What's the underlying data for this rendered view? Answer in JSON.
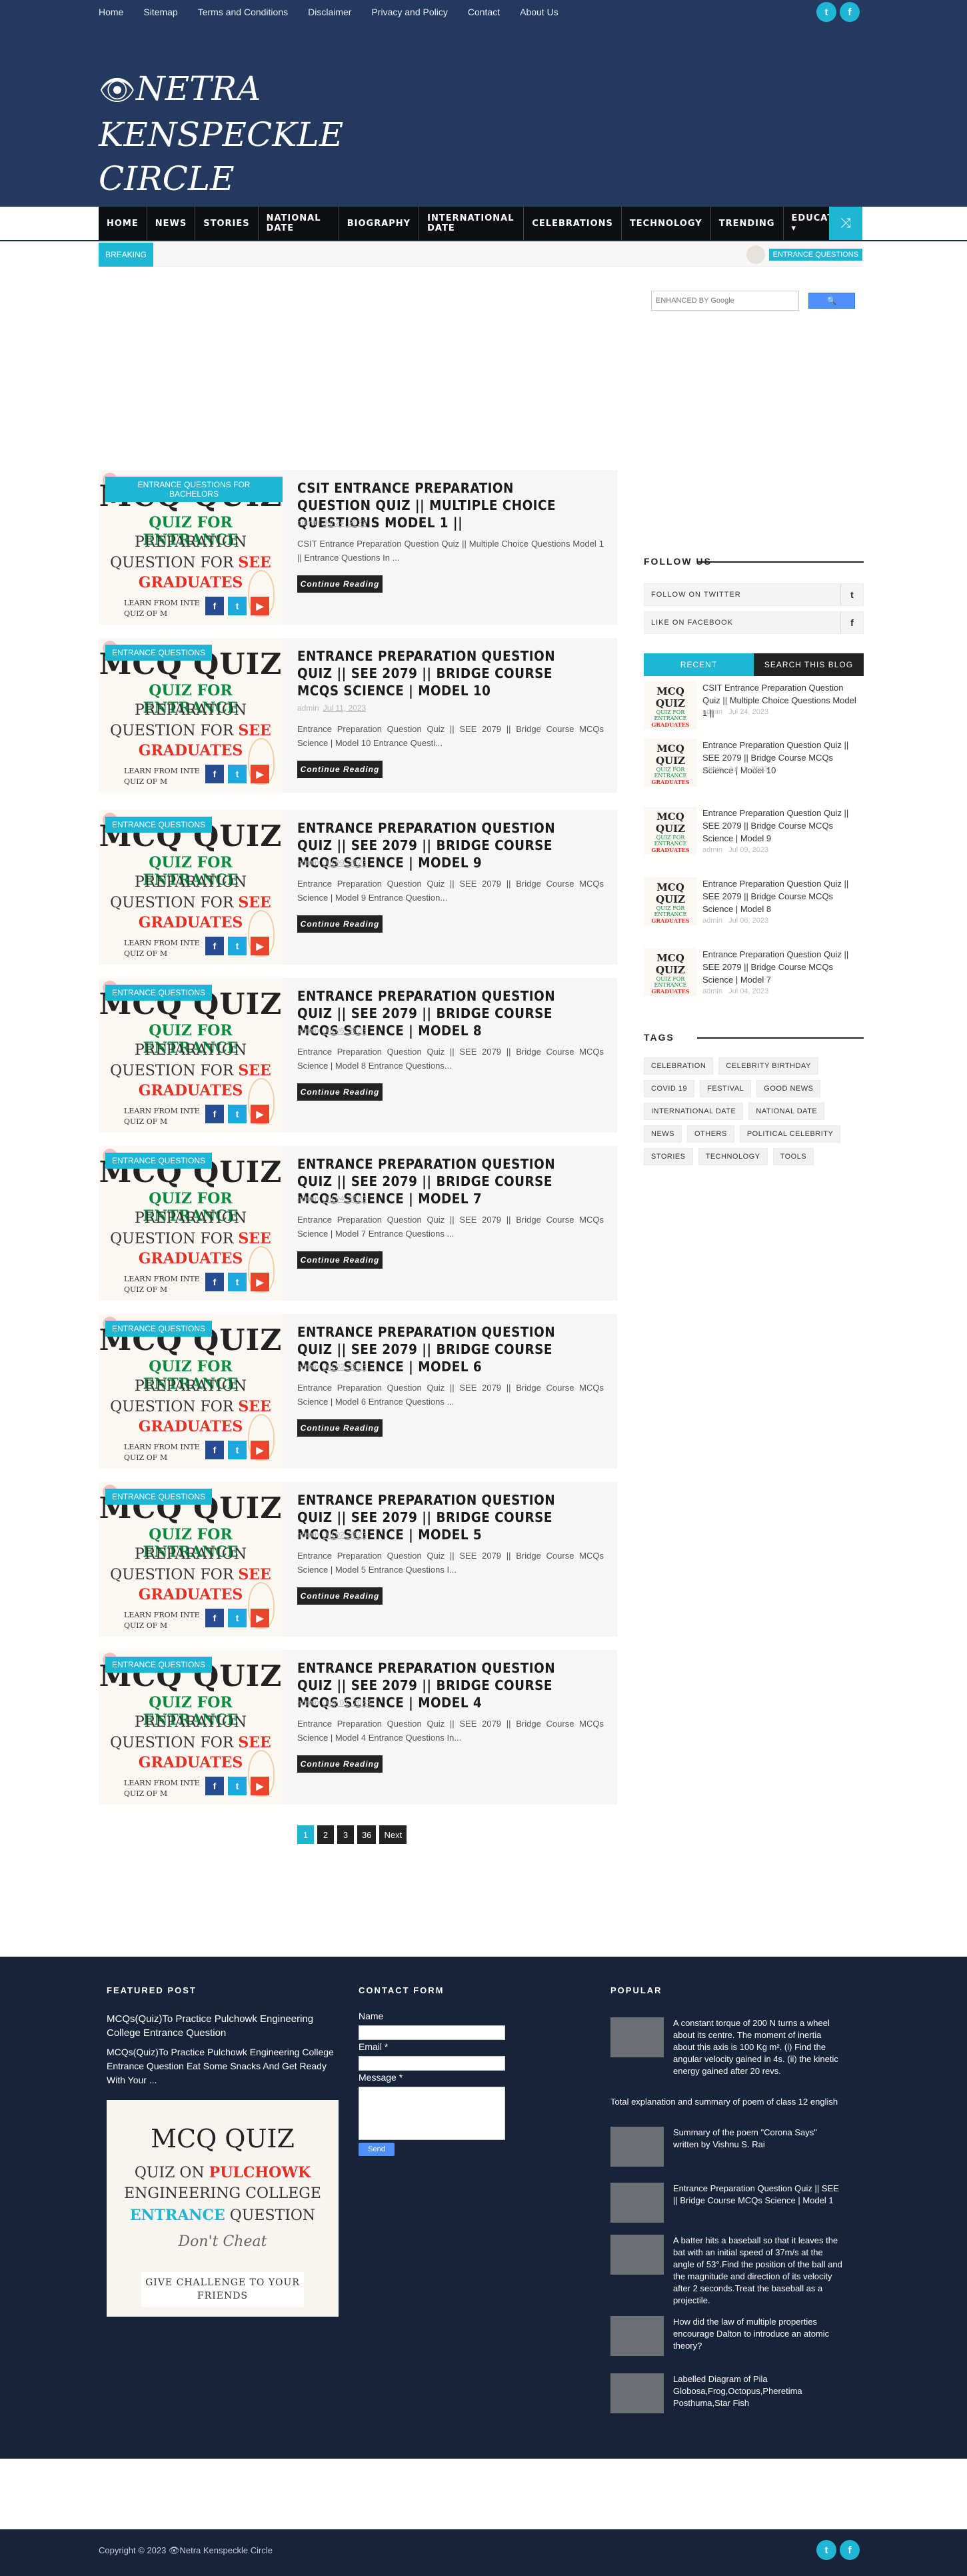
{
  "topnav": [
    "Home",
    "Sitemap",
    "Terms and Conditions",
    "Disclaimer",
    "Privacy and Policy",
    "Contact",
    "About Us"
  ],
  "social": {
    "twitter": "t",
    "facebook": "f"
  },
  "site": {
    "title_line1": "NETRA",
    "title_line2": "KENSPECKLE",
    "title_line3": "CIRCLE",
    "eye": "👁"
  },
  "mainnav": [
    "HOME",
    "NEWS",
    "STORIES",
    "NATIONAL DATE",
    "BIOGRAPHY",
    "INTERNATIONAL DATE",
    "CELEBRATIONS",
    "TECHNOLOGY",
    "TRENDING",
    "EDUCATION ▾"
  ],
  "ticker": {
    "label": "BREAKING",
    "tag": "ENTRANCE QUESTIONS"
  },
  "search": {
    "placeholder": "ENHANCED BY Google",
    "button": "🔍"
  },
  "posts": [
    {
      "category": "ENTRANCE QUESTIONS FOR BACHELORS",
      "title": "CSIT ENTRANCE PREPARATION QUESTION QUIZ || MULTIPLE CHOICE QUESTIONS MODEL 1 ||",
      "author": "admin",
      "date": "Jul 24, 2023",
      "excerpt": "CSIT Entrance Preparation Question Quiz || Multiple Choice Questions Model 1 || Entrance Questions In ..."
    },
    {
      "category": "ENTRANCE QUESTIONS",
      "title": "ENTRANCE PREPARATION QUESTION QUIZ || SEE 2079 || BRIDGE COURSE MCQS SCIENCE | MODEL 10",
      "author": "admin",
      "date": "Jul 11, 2023",
      "excerpt": "Entrance Preparation Question Quiz || SEE 2079 || Bridge Course MCQs Science | Model 10 Entrance Questi..."
    },
    {
      "category": "ENTRANCE QUESTIONS",
      "title": "ENTRANCE PREPARATION QUESTION QUIZ || SEE 2079 || BRIDGE COURSE MCQS SCIENCE | MODEL 9",
      "author": "admin",
      "date": "Jul 09, 2023",
      "excerpt": "Entrance Preparation Question Quiz || SEE 2079 || Bridge Course MCQs Science | Model 9 Entrance Question..."
    },
    {
      "category": "ENTRANCE QUESTIONS",
      "title": "ENTRANCE PREPARATION QUESTION QUIZ || SEE 2079 || BRIDGE COURSE MCQS SCIENCE | MODEL 8",
      "author": "admin",
      "date": "Jul 06, 2023",
      "excerpt": "Entrance Preparation Question Quiz || SEE 2079 || Bridge Course MCQs Science | Model 8 Entrance Questions..."
    },
    {
      "category": "ENTRANCE QUESTIONS",
      "title": "ENTRANCE PREPARATION QUESTION QUIZ || SEE 2079 || BRIDGE COURSE MCQS SCIENCE | MODEL 7",
      "author": "admin",
      "date": "Jul 04, 2023",
      "excerpt": "Entrance Preparation Question Quiz || SEE 2079 || Bridge Course MCQs Science | Model 7 Entrance Questions ..."
    },
    {
      "category": "ENTRANCE QUESTIONS",
      "title": "ENTRANCE PREPARATION QUESTION QUIZ || SEE 2079 || BRIDGE COURSE MCQS SCIENCE | MODEL 6",
      "author": "admin",
      "date": "Jul 02, 2023",
      "excerpt": "Entrance Preparation Question Quiz || SEE 2079 || Bridge Course MCQs Science | Model 6 Entrance Questions ..."
    },
    {
      "category": "ENTRANCE QUESTIONS",
      "title": "ENTRANCE PREPARATION QUESTION QUIZ || SEE 2079 || BRIDGE COURSE MCQS SCIENCE | MODEL 5",
      "author": "admin",
      "date": "Jul 02, 2023",
      "excerpt": "Entrance Preparation Question Quiz || SEE 2079 || Bridge Course MCQs Science | Model 5 Entrance Questions I..."
    },
    {
      "category": "ENTRANCE QUESTIONS",
      "title": "ENTRANCE PREPARATION QUESTION QUIZ || SEE 2079 || BRIDGE COURSE MCQS SCIENCE | MODEL 4",
      "author": "admin",
      "date": "July 01, 2023",
      "excerpt": "Entrance Preparation Question Quiz || SEE 2079 || Bridge Course MCQs Science | Model 4 Entrance Questions In..."
    }
  ],
  "thumb": {
    "t1": "MCQ QUIZ",
    "t2": "QUIZ FOR ENTRANCE",
    "t3": "PREPARATION",
    "t4a": "QUESTION FOR ",
    "t4b": "SEE",
    "t5": "GRADUATES",
    "t6": "LEARN FROM INTE QUIZ OF M"
  },
  "read_more": "Continue Reading",
  "pager": [
    "1",
    "2",
    "3",
    "36",
    "Next"
  ],
  "sidebar": {
    "follow_heading": "FOLLOW US",
    "follow": [
      {
        "label": "FOLLOW ON TWITTER",
        "icon": "t"
      },
      {
        "label": "LIKE ON FACEBOOK",
        "icon": "f"
      }
    ],
    "tab_recent": "RECENT",
    "tab_search": "SEARCH THIS BLOG",
    "recent": [
      {
        "title": "CSIT Entrance Preparation Question Quiz || Multiple Choice Questions Model 1 ||",
        "date": "Jul 24, 2023"
      },
      {
        "title": "Entrance Preparation Question Quiz || SEE 2079 || Bridge Course MCQs Science | Model 10",
        "date": "Jul 11, 2023"
      },
      {
        "title": "Entrance Preparation Question Quiz || SEE 2079 || Bridge Course MCQs Science | Model 9",
        "date": "Jul 09, 2023"
      },
      {
        "title": "Entrance Preparation Question Quiz || SEE 2079 || Bridge Course MCQs Science | Model 8",
        "date": "Jul 06, 2023"
      },
      {
        "title": "Entrance Preparation Question Quiz || SEE 2079 || Bridge Course MCQs Science | Model 7",
        "date": "Jul 04, 2023"
      }
    ],
    "recent_author": "admin",
    "tags_heading": "TAGS",
    "tags": [
      "CELEBRATION",
      "CELEBRITY BIRTHDAY",
      "COVID 19",
      "FESTIVAL",
      "GOOD NEWS",
      "INTERNATIONAL DATE",
      "NATIONAL DATE",
      "NEWS",
      "OTHERS",
      "POLITICAL CELEBRITY",
      "STORIES",
      "TECHNOLOGY",
      "TOOLS"
    ]
  },
  "footer": {
    "featured_heading": "FEATURED POST",
    "featured_title": "MCQs(Quiz)To Practice Pulchowk Engineering College Entrance Question",
    "featured_excerpt": "MCQs(Quiz)To Practice Pulchowk Engineering College Entrance Question Eat Some Snacks And Get Ready With Your ...",
    "fimg": {
      "f1": "MCQ QUIZ",
      "f2a": "QUIZ ON ",
      "f2b": "PULCHOWK",
      "f3": "ENGINEERING COLLEGE",
      "f4a": "ENTRANCE",
      "f4b": " QUESTION",
      "f5": "Don't Cheat",
      "f6": "GIVE CHALLENGE TO YOUR FRIENDS"
    },
    "contact_heading": "CONTACT FORM",
    "name_label": "Name",
    "email_label": "Email *",
    "message_label": "Message *",
    "send": "Send",
    "popular_heading": "POPULAR",
    "popular": [
      "A constant torque of 200 N turns a wheel about its centre. The moment of inertia about this axis is 100 Kg m². (i) Find the angular velocity gained in 4s. (ii) the kinetic energy gained after 20 revs.",
      "Total explanation and summary of poem of class 12 english",
      "Summary of the poem \"Corona Says\" written by Vishnu S. Rai",
      "Entrance Preparation Question Quiz || SEE || Bridge Course MCQs Science | Model 1",
      "A batter hits a baseball so that it leaves the bat with an initial speed of 37m/s at the angle of 53°.Find the position of the ball and the magnitude and direction of its velocity after 2 seconds.Treat the baseball as a projectile.",
      "How did the law of multiple properties encourage Dalton to introduce an atomic theory?",
      "Labelled Diagram of Pila Globosa,Frog,Octopus,Pheretima Posthuma,Star Fish"
    ],
    "copyright": "Copyright © 2023 👁Netra Kenspeckle Circle"
  }
}
